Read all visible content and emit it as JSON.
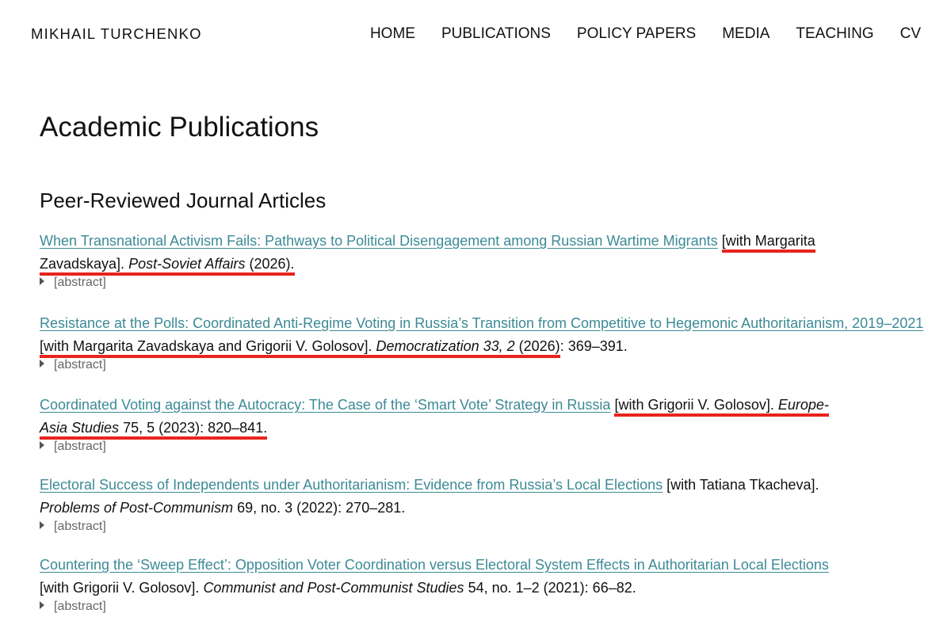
{
  "header": {
    "site_title": "MIKHAIL TURCHENKO",
    "nav": [
      "HOME",
      "PUBLICATIONS",
      "POLICY PAPERS",
      "MEDIA",
      "TEACHING",
      "CV"
    ]
  },
  "page": {
    "title": "Academic Publications",
    "section_title": "Peer-Reviewed Journal Articles",
    "abstract_label": "[abstract]"
  },
  "publications": [
    {
      "title": "When Transnational Activism Fails: Pathways to Political Disengagement among Russian Wartime Migrants",
      "coauthors_a": "[with Margarita",
      "coauthors_b": "Zavadskaya].",
      "journal": "Post-Soviet Affairs",
      "details": " (2026)."
    },
    {
      "title": "Resistance at the Polls: Coordinated Anti-Regime Voting in Russia’s Transition from Competitive to Hegemonic Authoritarianism, 2019–2021",
      "coauthors": "[with Margarita Zavadskaya and Grigorii V. Golosov].",
      "journal": "Democratization 33, 2",
      "details_hl": " (2026)",
      "details": ": 369–391."
    },
    {
      "title": "Coordinated Voting against the Autocracy: The Case of the ‘Smart Vote’ Strategy in Russia",
      "coauthors": "[with Grigorii V. Golosov].",
      "journal_a": "Europe-",
      "journal_b": "Asia Studies",
      "details": " 75, 5 (2023): 820–841."
    },
    {
      "title": "Electoral Success of Independents under Authoritarianism: Evidence from Russia’s Local Elections",
      "coauthors": "[with Tatiana Tkacheva].",
      "journal": "Problems of Post-Communism",
      "details": " 69, no. 3 (2022): 270–281."
    },
    {
      "title": "Countering the ‘Sweep Effect’: Opposition Voter Coordination versus Electoral System Effects in Authoritarian Local Elections",
      "coauthors": "[with Grigorii V. Golosov].",
      "journal": "Communist and Post-Communist Studies",
      "details": " 54, no. 1–2 (2021): 66–82."
    }
  ],
  "colors": {
    "link": "#3c8a96",
    "highlight": "#e8241c",
    "text": "#111111"
  }
}
